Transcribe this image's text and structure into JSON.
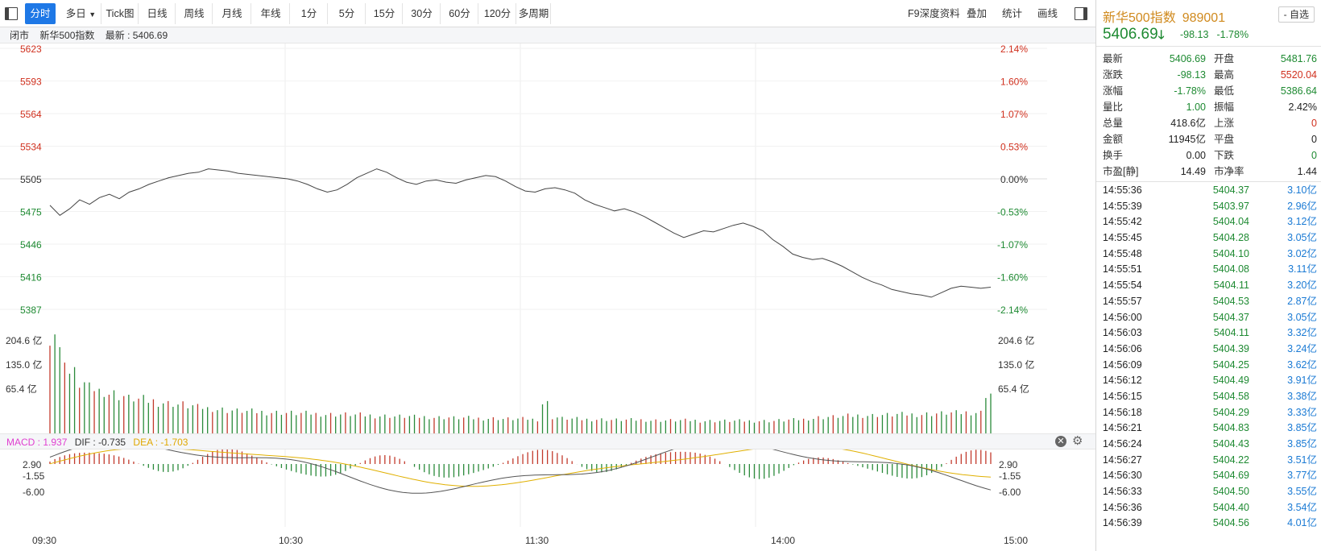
{
  "toolbar": {
    "tabs": [
      "分时",
      "多日",
      "Tick图",
      "日线",
      "周线",
      "月线",
      "年线",
      "1分",
      "5分",
      "15分",
      "30分",
      "60分",
      "120分",
      "多周期"
    ],
    "right_items": [
      "F9深度资料",
      "叠加",
      "统计",
      "画线"
    ]
  },
  "infobar": {
    "status": "闭市",
    "name": "新华500指数",
    "latest": "最新 : 5406.69"
  },
  "price_axis": {
    "left": [
      "5623",
      "5593",
      "5564",
      "5534",
      "5505",
      "5475",
      "5446",
      "5416",
      "5387"
    ],
    "right": [
      "2.14%",
      "1.60%",
      "1.07%",
      "0.53%",
      "0.00%",
      "-0.53%",
      "-1.07%",
      "-1.60%",
      "-2.14%"
    ]
  },
  "volume_axis": {
    "labels": [
      "204.6 亿",
      "135.0 亿",
      "65.4 亿"
    ]
  },
  "macd": {
    "label": "MACD : 1.937",
    "dif": "DIF : -0.735",
    "dea": "DEA : -1.703",
    "axis": [
      "2.90",
      "-1.55",
      "-6.00"
    ],
    "close_icon": "close-icon",
    "gear_icon": "gear-icon"
  },
  "time_axis": [
    "09:30",
    "10:30",
    "11:30",
    "14:00",
    "15:00"
  ],
  "chart_data": {
    "type": "line",
    "title": "新华500指数",
    "x": [
      "09:30",
      "10:30",
      "11:30",
      "14:00",
      "15:00"
    ],
    "prev_close": 5504.82,
    "ylim": [
      5387,
      5623
    ],
    "series": [
      {
        "name": "新华500指数",
        "values": [
          5481,
          5472,
          5478,
          5486,
          5482,
          5488,
          5491,
          5487,
          5493,
          5496,
          5500,
          5503,
          5506,
          5508,
          5510,
          5511,
          5514,
          5513,
          5512,
          5510,
          5509,
          5508,
          5507,
          5506,
          5505,
          5503,
          5500,
          5496,
          5493,
          5495,
          5500,
          5506,
          5510,
          5514,
          5511,
          5506,
          5502,
          5500,
          5503,
          5504,
          5502,
          5501,
          5504,
          5506,
          5508,
          5507,
          5503,
          5498,
          5494,
          5493,
          5496,
          5497,
          5495,
          5492,
          5486,
          5482,
          5479,
          5476,
          5478,
          5475,
          5471,
          5466,
          5461,
          5456,
          5452,
          5455,
          5458,
          5457,
          5460,
          5463,
          5465,
          5462,
          5458,
          5450,
          5444,
          5437,
          5434,
          5432,
          5433,
          5430,
          5426,
          5421,
          5416,
          5412,
          5409,
          5405,
          5403,
          5401,
          5400,
          5398,
          5402,
          5406,
          5408,
          5407,
          5406,
          5407
        ]
      },
      {
        "name": "成交量(亿)",
        "values": [
          204.6,
          160,
          120,
          100,
          90,
          85,
          80,
          75,
          70,
          68,
          65,
          62,
          60,
          58,
          55,
          52,
          50,
          48,
          46,
          45,
          44,
          43,
          42,
          42,
          41,
          40,
          40,
          39,
          38,
          38,
          38,
          37,
          36,
          35,
          35,
          34,
          34,
          33,
          33,
          32,
          32,
          31,
          31,
          30,
          30,
          30,
          29,
          29,
          29,
          28,
          60,
          32,
          30,
          29,
          28,
          28,
          28,
          27,
          27,
          27,
          27,
          26,
          26,
          26,
          26,
          26,
          25,
          25,
          25,
          25,
          25,
          25,
          25,
          25,
          26,
          27,
          28,
          30,
          32,
          33,
          34,
          35,
          36,
          36,
          37,
          37,
          38,
          38,
          38,
          39,
          40,
          41,
          41,
          42,
          42,
          80
        ]
      }
    ]
  },
  "right_panel": {
    "name": "新华500指数",
    "code": "989001",
    "add_label": "- 自选",
    "price": "5406.69",
    "arrow": "down-arrow-icon",
    "change": "-98.13",
    "change_pct": "-1.78%",
    "stats": [
      {
        "l1": "最新",
        "v1": "5406.69",
        "c1": "green",
        "l2": "开盘",
        "v2": "5481.76",
        "c2": "green"
      },
      {
        "l1": "涨跌",
        "v1": "-98.13",
        "c1": "green",
        "l2": "最高",
        "v2": "5520.04",
        "c2": "red"
      },
      {
        "l1": "涨幅",
        "v1": "-1.78%",
        "c1": "green",
        "l2": "最低",
        "v2": "5386.64",
        "c2": "green"
      },
      {
        "l1": "量比",
        "v1": "1.00",
        "c1": "green",
        "l2": "振幅",
        "v2": "2.42%",
        "c2": "dark"
      },
      {
        "l1": "总量",
        "v1": "418.6亿",
        "c1": "dark",
        "l2": "上涨",
        "v2": "0",
        "c2": "red"
      },
      {
        "l1": "金额",
        "v1": "11945亿",
        "c1": "dark",
        "l2": "平盘",
        "v2": "0",
        "c2": "dark"
      },
      {
        "l1": "换手",
        "v1": "0.00",
        "c1": "dark",
        "l2": "下跌",
        "v2": "0",
        "c2": "green"
      },
      {
        "l1": "市盈[静]",
        "v1": "14.49",
        "c1": "dark",
        "l2": "市净率",
        "v2": "1.44",
        "c2": "dark"
      }
    ],
    "ticks": [
      {
        "t": "14:55:36",
        "p": "5404.37",
        "q": "3.10亿"
      },
      {
        "t": "14:55:39",
        "p": "5403.97",
        "q": "2.96亿"
      },
      {
        "t": "14:55:42",
        "p": "5404.04",
        "q": "3.12亿"
      },
      {
        "t": "14:55:45",
        "p": "5404.28",
        "q": "3.05亿"
      },
      {
        "t": "14:55:48",
        "p": "5404.10",
        "q": "3.02亿"
      },
      {
        "t": "14:55:51",
        "p": "5404.08",
        "q": "3.11亿"
      },
      {
        "t": "14:55:54",
        "p": "5404.11",
        "q": "3.20亿"
      },
      {
        "t": "14:55:57",
        "p": "5404.53",
        "q": "2.87亿"
      },
      {
        "t": "14:56:00",
        "p": "5404.37",
        "q": "3.05亿"
      },
      {
        "t": "14:56:03",
        "p": "5404.11",
        "q": "3.32亿"
      },
      {
        "t": "14:56:06",
        "p": "5404.39",
        "q": "3.24亿"
      },
      {
        "t": "14:56:09",
        "p": "5404.25",
        "q": "3.62亿"
      },
      {
        "t": "14:56:12",
        "p": "5404.49",
        "q": "3.91亿"
      },
      {
        "t": "14:56:15",
        "p": "5404.58",
        "q": "3.38亿"
      },
      {
        "t": "14:56:18",
        "p": "5404.29",
        "q": "3.33亿"
      },
      {
        "t": "14:56:21",
        "p": "5404.83",
        "q": "3.85亿"
      },
      {
        "t": "14:56:24",
        "p": "5404.43",
        "q": "3.85亿"
      },
      {
        "t": "14:56:27",
        "p": "5404.22",
        "q": "3.51亿"
      },
      {
        "t": "14:56:30",
        "p": "5404.69",
        "q": "3.77亿"
      },
      {
        "t": "14:56:33",
        "p": "5404.50",
        "q": "3.55亿"
      },
      {
        "t": "14:56:36",
        "p": "5404.40",
        "q": "3.54亿"
      },
      {
        "t": "14:56:39",
        "p": "5404.56",
        "q": "4.01亿"
      }
    ]
  },
  "colors": {
    "accent": "#1e78e6",
    "up": "#d0301e",
    "down": "#1e8a32",
    "macd_label": "#e040d0",
    "dea_line": "#e0a800"
  }
}
